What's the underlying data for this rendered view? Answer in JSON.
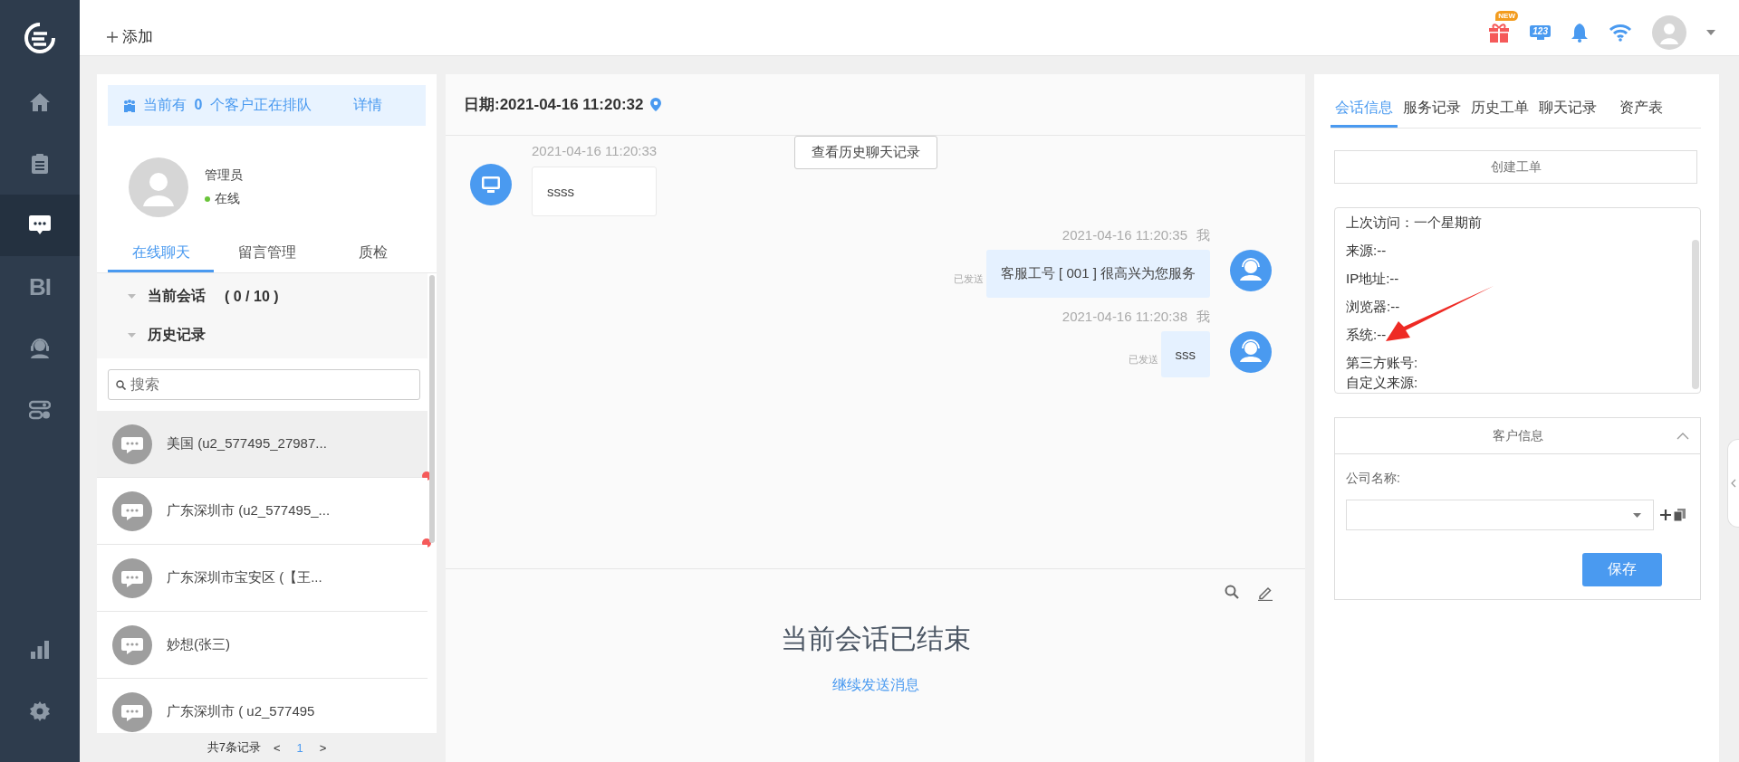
{
  "sidebar": {
    "main_items": [
      {
        "kind": "home",
        "selected": false
      },
      {
        "kind": "clipboard",
        "selected": false
      },
      {
        "kind": "chat",
        "selected": true
      },
      {
        "kind": "text",
        "label": "BI",
        "selected": false
      },
      {
        "kind": "headset",
        "selected": false
      },
      {
        "kind": "toggles",
        "selected": false
      }
    ],
    "bottom_items": [
      {
        "kind": "chart",
        "selected": false
      },
      {
        "kind": "gear",
        "selected": false
      }
    ]
  },
  "header": {
    "add_button": "添加",
    "gift_badge": "NEW",
    "monitor_label": "123"
  },
  "queue": {
    "text": "当前有 **0** 个客户正在排队",
    "link": "详情"
  },
  "agent": {
    "name": "管理员",
    "status": "在线",
    "online": true
  },
  "left_tabs": [
    {
      "label": "在线聊天",
      "selected": true
    },
    {
      "label": "留言管理",
      "selected": false
    },
    {
      "label": "质检",
      "selected": false
    }
  ],
  "session_groups": [
    {
      "label": "当前会话",
      "count": "( 0 / 10 )",
      "expanded": true
    },
    {
      "label": "历史记录",
      "expanded": true
    }
  ],
  "search": {
    "placeholder": "搜索"
  },
  "conversations": [
    {
      "name": "美国 (u2_577495_27987...",
      "selected": true,
      "unread": true
    },
    {
      "name": "广东深圳市 (u2_577495_...",
      "selected": false,
      "unread": true
    },
    {
      "name": "广东深圳市宝安区 (【王...",
      "selected": false,
      "unread": false
    },
    {
      "name": "妙想(张三)",
      "selected": false,
      "unread": false
    },
    {
      "name": "广东深圳市 ( u2_577495",
      "selected": false,
      "unread": false
    }
  ],
  "pagination": {
    "total": "共7条记录",
    "prev": "<",
    "pages": [
      {
        "label": "1",
        "selected": true
      }
    ],
    "next": ">"
  },
  "chat": {
    "date": "日期:2021-04-16 11:20:32",
    "history_button": "查看历史聊天记录",
    "messages": [
      {
        "kind": "visitor",
        "time": "2021-04-16 11:20:33",
        "text": "ssss"
      },
      {
        "kind": "agent",
        "time": "2021-04-16 11:20:35",
        "sender": "我",
        "status": "已发送",
        "text": "客服工号 [ 001 ] 很高兴为您服务"
      },
      {
        "kind": "agent",
        "time": "2021-04-16 11:20:38",
        "sender": "我",
        "status": "已发送",
        "text": "sss"
      }
    ],
    "ended_text": "当前会话已结束",
    "continue_link": "继续发送消息"
  },
  "right_tabs": [
    {
      "label": "会话信息",
      "selected": true
    },
    {
      "label": "服务记录",
      "selected": false
    },
    {
      "label": "历史工单",
      "selected": false
    },
    {
      "label": "聊天记录",
      "selected": false
    },
    {
      "label": "资产表",
      "selected": false
    }
  ],
  "create_ticket_button": "创建工单",
  "visit_info": [
    "上次访问：一个星期前",
    "来源:--",
    "IP地址:--",
    "浏览器:--",
    "系统:--",
    "第三方账号:",
    "自定义来源:"
  ],
  "customer_info": {
    "title": "客户信息",
    "expanded": true,
    "company_label": "公司名称:",
    "save_button": "保存"
  }
}
